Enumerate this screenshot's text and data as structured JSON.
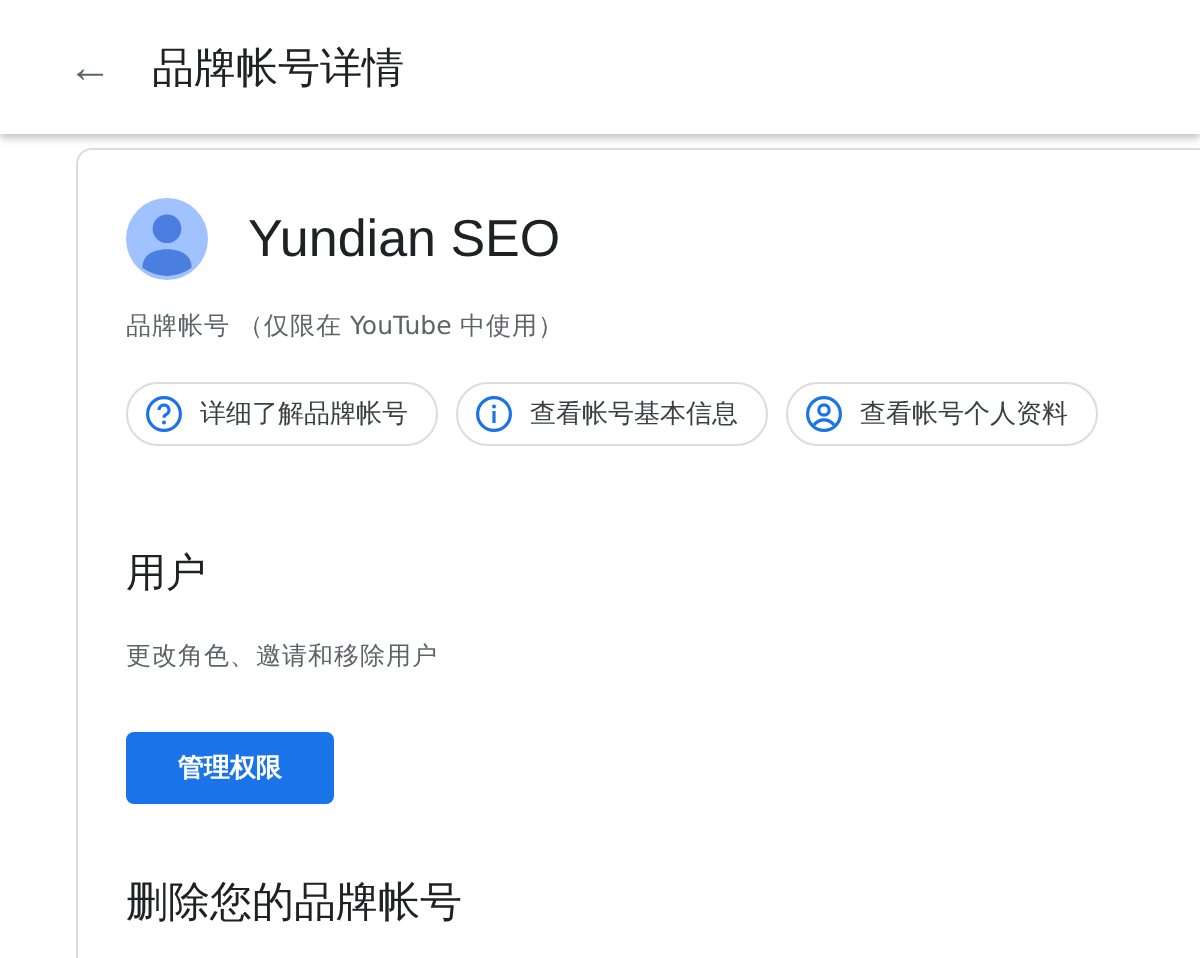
{
  "header": {
    "back_icon": "←",
    "title": "品牌帐号详情"
  },
  "account": {
    "name": "Yundian SEO",
    "subtitle": "品牌帐号 （仅限在 YouTube 中使用）"
  },
  "chips": [
    {
      "kind": "help",
      "label": "详细了解品牌帐号"
    },
    {
      "kind": "info",
      "label": "查看帐号基本信息"
    },
    {
      "kind": "profile",
      "label": "查看帐号个人资料"
    }
  ],
  "users_section": {
    "title": "用户",
    "description": "更改角色、邀请和移除用户",
    "button": "管理权限"
  },
  "delete_section": {
    "title": "删除您的品牌帐号"
  }
}
